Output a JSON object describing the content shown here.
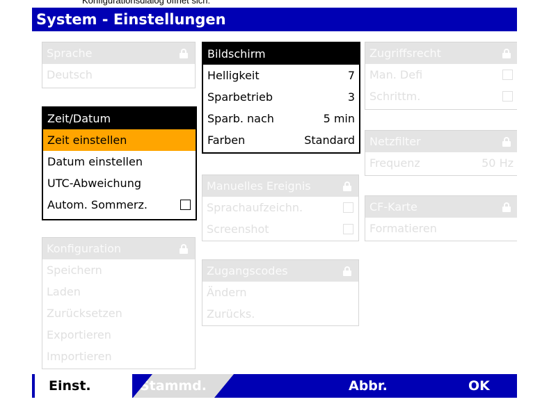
{
  "caption": "Konfigurationsdialog öffnet sich:",
  "title": "System - Einstellungen",
  "panels": {
    "sprache": {
      "header": "Sprache",
      "rows": [
        "Deutsch"
      ]
    },
    "zeit": {
      "header": "Zeit/Datum",
      "rows": [
        "Zeit einstellen",
        "Datum einstellen",
        "UTC-Abweichung",
        "Autom. Sommerz."
      ]
    },
    "konfig": {
      "header": "Konfiguration",
      "rows": [
        "Speichern",
        "Laden",
        "Zurücksetzen",
        "Exportieren",
        "Importieren"
      ]
    },
    "bildschirm": {
      "header": "Bildschirm",
      "rows": [
        {
          "label": "Helligkeit",
          "value": "7"
        },
        {
          "label": "Sparbetrieb",
          "value": "3"
        },
        {
          "label": "Sparb. nach",
          "value": "5 min"
        },
        {
          "label": "Farben",
          "value": "Standard"
        }
      ]
    },
    "ereignis": {
      "header": "Manuelles Ereignis",
      "rows": [
        "Sprachaufzeichn.",
        "Screenshot"
      ]
    },
    "zugang": {
      "header": "Zugangscodes",
      "rows": [
        "Ändern",
        "Zurücks."
      ]
    },
    "zugriff": {
      "header": "Zugriffsrecht",
      "rows": [
        "Man. Defi",
        "Schrittm."
      ]
    },
    "netz": {
      "header": "Netzfilter",
      "rows": [
        {
          "label": "Frequenz",
          "value": "50 Hz"
        }
      ]
    },
    "cf": {
      "header": "CF-Karte",
      "rows": [
        "Formatieren"
      ]
    }
  },
  "tabs": {
    "active": "Einst.",
    "inactive": "Stammd."
  },
  "softkeys": {
    "cancel": "Abbr.",
    "ok": "OK"
  },
  "colors": {
    "titlebar": "#0000b4",
    "selection": "#ffa500",
    "disabled_header": "#e4e4e4",
    "disabled_text": "#e0e0e0"
  }
}
